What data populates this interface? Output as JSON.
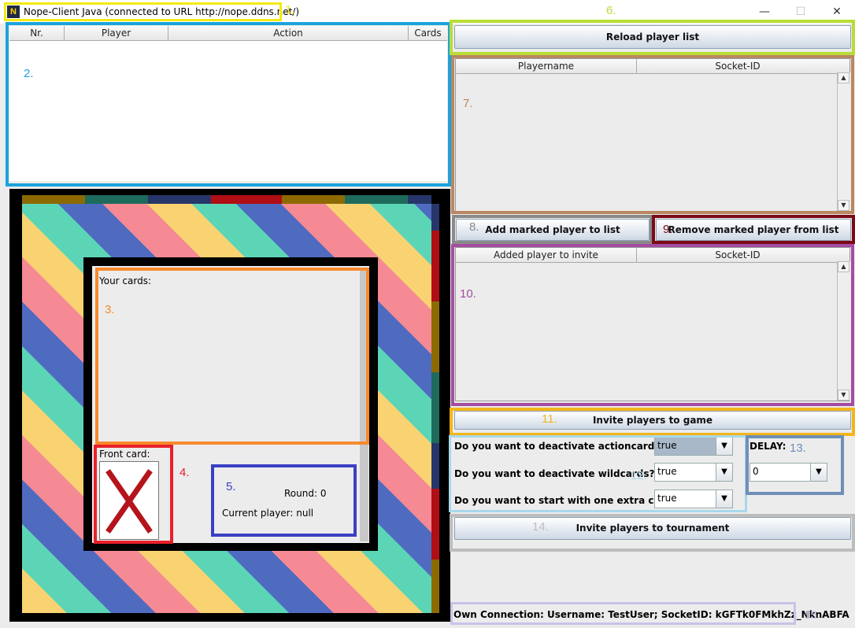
{
  "window": {
    "title": "Nope-Client Java (connected to URL http://nope.ddns.net/)",
    "app_icon": "N",
    "controls": {
      "minimize": "—",
      "maximize": "☐",
      "close": "✕"
    }
  },
  "annotations": [
    "1.",
    "2.",
    "3.",
    "4.",
    "5.",
    "6.",
    "7.",
    "8.",
    "9.",
    "10.",
    "11.",
    "12.",
    "13.",
    "14.",
    "15."
  ],
  "game_table": {
    "columns": [
      "Nr.",
      "Player",
      "Action",
      "Cards"
    ]
  },
  "board": {
    "your_cards_label": "Your cards:",
    "front_card_label": "Front card:",
    "round_text": "Round: 0",
    "current_player_text": "Current player: null"
  },
  "reload_button": "Reload player list",
  "player_list": {
    "columns": [
      "Playername",
      "Socket-ID"
    ]
  },
  "add_button": "Add marked player to list",
  "remove_button": "Remove marked player from list",
  "invite_list": {
    "columns": [
      "Added player to invite",
      "Socket-ID"
    ]
  },
  "invite_game_button": "Invite players to game",
  "options": [
    {
      "question": "Do you want to deactivate actioncards?",
      "value": "true"
    },
    {
      "question": "Do you want to deactivate wildcards??",
      "value": "true"
    },
    {
      "question": "Do you want to start with one extra card?",
      "value": "true"
    }
  ],
  "delay": {
    "label": "DELAY:",
    "value": "0"
  },
  "invite_tournament_button": "Invite players to tournament",
  "status": "Own Connection: Username: TestUser; SocketID: kGFTk0FMkhZz_NknABFA",
  "colors": {
    "stripe": [
      "#f9d371",
      "#5cd5b7",
      "#4f6bbf",
      "#f58a94"
    ],
    "anno1": "#f4ea13",
    "anno2": "#1ba3dd",
    "anno3": "#f78a2c",
    "anno4": "#e8202a",
    "anno5": "#3a40c4",
    "anno6": "#b9dd36",
    "anno7": "#b98761",
    "anno8": "#8a8a8a",
    "anno9": "#7a0b17",
    "anno10": "#a54ca2",
    "anno11": "#f3b51a",
    "anno12": "#a8d8ea",
    "anno13": "#6f8fb8",
    "anno14": "#bdbdbd",
    "anno15": "#c9c2e8"
  }
}
